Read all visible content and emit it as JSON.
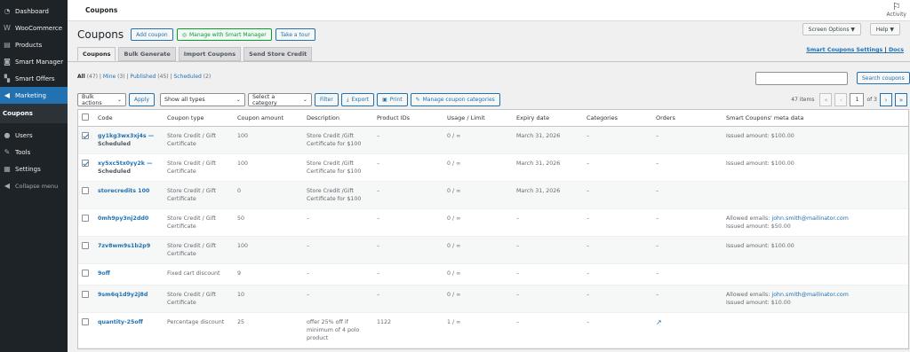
{
  "sidebar": {
    "items": [
      {
        "label": "Dashboard",
        "icon": "dashboard-icon",
        "glyph": "◔"
      },
      {
        "label": "WooCommerce",
        "icon": "woocommerce-icon",
        "glyph": "W"
      },
      {
        "label": "Products",
        "icon": "products-icon",
        "glyph": "▤"
      },
      {
        "label": "Smart Manager",
        "icon": "smart-manager-icon",
        "glyph": "◙"
      },
      {
        "label": "Smart Offers",
        "icon": "smart-offers-icon",
        "glyph": "▚"
      },
      {
        "label": "Marketing",
        "icon": "marketing-icon",
        "glyph": "◀"
      }
    ],
    "submenu_active": "Coupons",
    "items_bottom": [
      {
        "label": "Users",
        "icon": "users-icon",
        "glyph": "●"
      },
      {
        "label": "Tools",
        "icon": "tools-icon",
        "glyph": "✎"
      },
      {
        "label": "Settings",
        "icon": "settings-icon",
        "glyph": "▦"
      }
    ],
    "collapse_label": "Collapse menu"
  },
  "topbar": {
    "title": "Coupons",
    "activity_label": "Activity"
  },
  "header": {
    "title": "Coupons",
    "add_coupon": "Add coupon",
    "manage_smart": "Manage with Smart Manager",
    "take_tour": "Take a tour",
    "screen_options": "Screen Options ▼",
    "help": "Help ▼",
    "smart_settings": "Smart Coupons Settings",
    "sep": " | ",
    "docs": "Docs"
  },
  "tabs": [
    "Coupons",
    "Bulk Generate",
    "Import Coupons",
    "Send Store Credit"
  ],
  "filters": {
    "all": "All",
    "all_count": "(47)",
    "mine": "Mine",
    "mine_count": "(3)",
    "published": "Published",
    "published_count": "(45)",
    "scheduled": "Scheduled",
    "scheduled_count": "(2)",
    "sep": " | "
  },
  "search": {
    "button": "Search coupons"
  },
  "tablenav": {
    "bulk_actions": "Bulk actions",
    "apply": "Apply",
    "show_all_types": "Show all types",
    "select_category": "Select a category",
    "filter": "Filter",
    "export": "Export",
    "print": "Print",
    "manage_categories": "Manage coupon categories",
    "items": "47 items",
    "page": "1",
    "of_pages": "of 3"
  },
  "columns": [
    "Code",
    "Coupon type",
    "Coupon amount",
    "Description",
    "Product IDs",
    "Usage / Limit",
    "Expiry date",
    "Categories",
    "Orders",
    "Smart Coupons' meta data"
  ],
  "rows": [
    {
      "checked": true,
      "code": "gy1kg3wx3xj4s —",
      "status": "Scheduled",
      "type": "Store Credit / Gift Certificate",
      "amount": "100",
      "description": "Store Credit /Gift Certificate for $100",
      "product_ids": "–",
      "usage": "0 / ∞",
      "expiry": "March 31, 2026",
      "categories": "–",
      "orders": "–",
      "meta": "Issued amount: $100.00",
      "meta_email": ""
    },
    {
      "checked": true,
      "code": "xy5xc5tx0yy2k —",
      "status": "Scheduled",
      "type": "Store Credit / Gift Certificate",
      "amount": "100",
      "description": "Store Credit /Gift Certificate for $100",
      "product_ids": "–",
      "usage": "0 / ∞",
      "expiry": "March 31, 2026",
      "categories": "–",
      "orders": "–",
      "meta": "Issued amount: $100.00",
      "meta_email": ""
    },
    {
      "checked": false,
      "code": "storecredits 100",
      "status": "",
      "type": "Store Credit / Gift Certificate",
      "amount": "0",
      "description": "Store Credit /Gift Certificate for $100",
      "product_ids": "–",
      "usage": "0 / ∞",
      "expiry": "March 31, 2026",
      "categories": "–",
      "orders": "–",
      "meta": "",
      "meta_email": ""
    },
    {
      "checked": false,
      "code": "0mh9py3nj2dd0",
      "status": "",
      "type": "Store Credit / Gift Certificate",
      "amount": "50",
      "description": "–",
      "product_ids": "–",
      "usage": "0 / ∞",
      "expiry": "–",
      "categories": "–",
      "orders": "–",
      "meta": "Issued amount: $50.00",
      "meta_email": "john.smith@mailinator.com"
    },
    {
      "checked": false,
      "code": "7zv8wm9s1b2p9",
      "status": "",
      "type": "Store Credit / Gift Certificate",
      "amount": "100",
      "description": "–",
      "product_ids": "–",
      "usage": "0 / ∞",
      "expiry": "–",
      "categories": "–",
      "orders": "–",
      "meta": "Issued amount: $100.00",
      "meta_email": ""
    },
    {
      "checked": false,
      "code": "9off",
      "status": "",
      "type": "Fixed cart discount",
      "amount": "9",
      "description": "–",
      "product_ids": "–",
      "usage": "0 / ∞",
      "expiry": "–",
      "categories": "–",
      "orders": "–",
      "meta": "",
      "meta_email": ""
    },
    {
      "checked": false,
      "code": "9sm6q1d9y2j8d",
      "status": "",
      "type": "Store Credit / Gift Certificate",
      "amount": "10",
      "description": "–",
      "product_ids": "–",
      "usage": "0 / ∞",
      "expiry": "–",
      "categories": "–",
      "orders": "–",
      "meta": "Issued amount: $10.00",
      "meta_email": "john.smith@mailinator.com"
    },
    {
      "checked": false,
      "code": "quantity-25off",
      "status": "",
      "type": "Percentage discount",
      "amount": "25",
      "description": "offer 25% off if minimum of 4 polo product",
      "product_ids": "1122",
      "usage": "1 / ∞",
      "expiry": "–",
      "categories": "–",
      "orders": "↗",
      "meta": "",
      "meta_email": ""
    }
  ],
  "allowed_emails_label": "Allowed emails: "
}
